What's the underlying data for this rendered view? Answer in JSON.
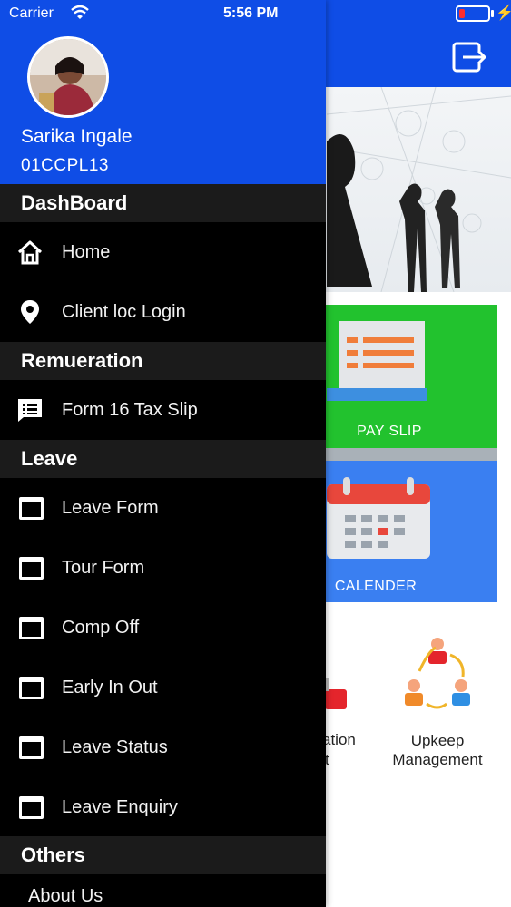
{
  "status_bar": {
    "carrier": "Carrier",
    "time": "5:56 PM"
  },
  "user": {
    "name": "Sarika Ingale",
    "code": "01CCPL13"
  },
  "menu": {
    "dashboard": {
      "title": "DashBoard",
      "items": [
        "Home",
        "Client loc Login"
      ]
    },
    "remuneration": {
      "title": "Remueration",
      "items": [
        "Form 16 Tax Slip"
      ]
    },
    "leave": {
      "title": "Leave",
      "items": [
        "Leave Form",
        "Tour Form",
        "Comp Off",
        "Early In Out",
        "Leave Status",
        "Leave Enquiry"
      ]
    },
    "others": {
      "title": "Others",
      "items": [
        "About Us"
      ]
    }
  },
  "background": {
    "tiles": {
      "pay_slip": "PAY SLIP",
      "calender": "CALENDER"
    },
    "cut_label_line1": "ation",
    "cut_label_line2": "t",
    "upkeep_label_line1": "Upkeep",
    "upkeep_label_line2": "Management"
  },
  "icons": {
    "home": "home-icon",
    "location": "location-pin-icon",
    "form16": "message-list-icon",
    "window": "window-icon",
    "logout": "logout-icon"
  },
  "colors": {
    "header_blue": "#0f4de6",
    "drawer_bg": "#000000",
    "section_bg": "#1b1b1b",
    "payslip_green": "#22c22e",
    "calendar_blue": "#3a7ff1"
  }
}
